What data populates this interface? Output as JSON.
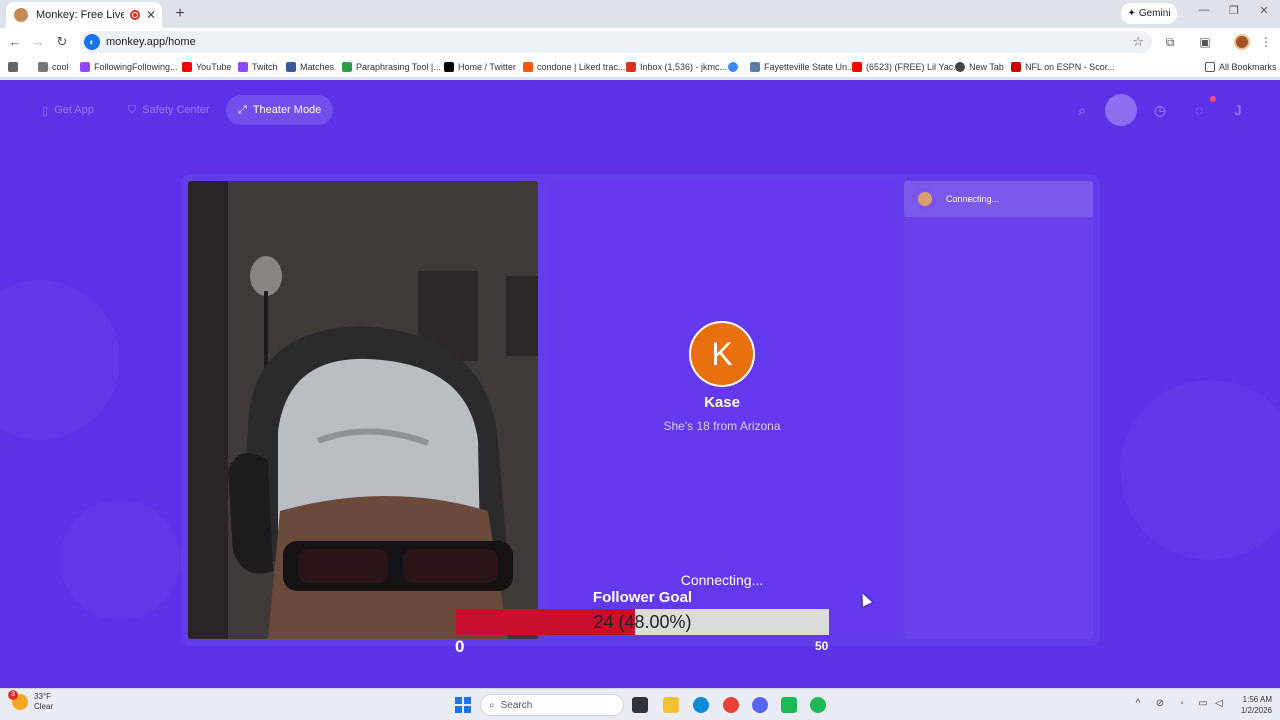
{
  "browser": {
    "tab_title": "Monkey: Free Live Video Ch",
    "new_tab": "+",
    "gemini_label": "Gemini",
    "url": "monkey.app/home",
    "bookmarks": [
      "cool",
      "FollowingFollowing...",
      "YouTube",
      "Twitch",
      "Matches",
      "Paraphrasing Tool |...",
      "Home / Twitter",
      "condone | Liked trac...",
      "Inbox (1,536) - jkmc...",
      "Fayetteville State Un...",
      "(6523) (FREE) Lil Yac...",
      "New Tab",
      "NFL on ESPN - Scor...",
      "All Bookmarks"
    ]
  },
  "page": {
    "nav": {
      "get_app": "Get App",
      "safety_center": "Safety Center",
      "theater_mode": "Theater Mode",
      "profile_initial": "J"
    },
    "chat": {
      "status": "Connecting..."
    },
    "match": {
      "initial": "K",
      "name": "Kase",
      "subtitle": "She's 18 from Arizona",
      "status": "Connecting..."
    },
    "follower_goal": {
      "label": "Follower Goal",
      "text": "24 (48.00%)",
      "current": 24,
      "max": 50,
      "progress": 0.48,
      "min_label": "0",
      "max_label": "50",
      "fill_color": "#c8102e"
    }
  },
  "taskbar": {
    "temperature": "33°F",
    "condition": "Clear",
    "weather_badge": "3",
    "search_placeholder": "Search",
    "time": "1:56 AM",
    "date": "1/2/2026"
  },
  "colors": {
    "page_bg": "#5b32e8",
    "remote_panel": "#6338ef",
    "avatar_orange": "#e9700f"
  }
}
